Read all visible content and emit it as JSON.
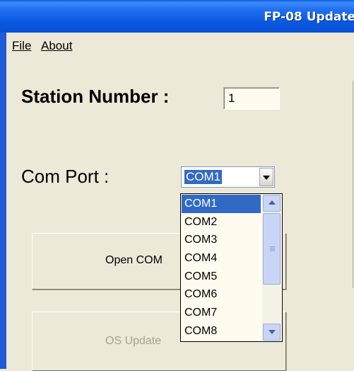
{
  "window": {
    "title": "FP-08 Update"
  },
  "menu": {
    "items": [
      "File",
      "About"
    ]
  },
  "form": {
    "station_label": "Station Number :",
    "station_value": "1",
    "com_label": "Com Port :",
    "com_selected": "COM1",
    "com_options": [
      "COM1",
      "COM2",
      "COM3",
      "COM4",
      "COM5",
      "COM6",
      "COM7",
      "COM8"
    ]
  },
  "buttons": {
    "open_label": "Open COM",
    "os_update_label": "OS Update"
  },
  "colors": {
    "titlebar": "#0a58e0",
    "selection": "#316ac5",
    "face": "#ece9d8",
    "field": "#fffbee"
  }
}
